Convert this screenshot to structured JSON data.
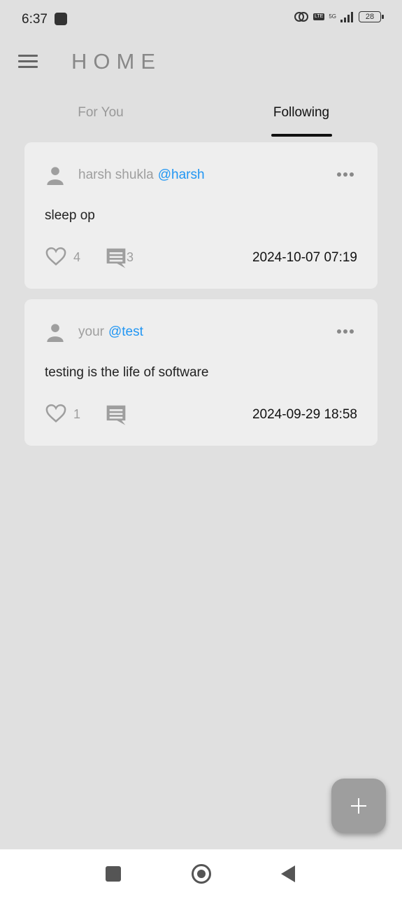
{
  "status_bar": {
    "time": "6:37",
    "network": "5G",
    "lte": "LTE",
    "battery": "28"
  },
  "app_bar": {
    "title": "HOME"
  },
  "tabs": [
    {
      "label": "For You",
      "selected": false
    },
    {
      "label": "Following",
      "selected": true
    }
  ],
  "posts": [
    {
      "author_name": "harsh shukla",
      "author_handle": "@harsh",
      "text": "sleep op",
      "likes": "4",
      "comments": "3",
      "timestamp": "2024-10-07 07:19"
    },
    {
      "author_name": "your",
      "author_handle": "@test",
      "text": "testing is the life of software",
      "likes": "1",
      "comments": "",
      "timestamp": "2024-09-29 18:58"
    }
  ],
  "colors": {
    "background": "#e0e0e0",
    "card": "#eeeeee",
    "handle": "#2196f3",
    "fab": "#9e9e9e"
  },
  "icons": {
    "menu": "menu-icon",
    "user": "person-icon",
    "more": "more-horizontal-icon",
    "like": "heart-outline-icon",
    "comment": "comment-icon",
    "fab": "plus-icon"
  }
}
